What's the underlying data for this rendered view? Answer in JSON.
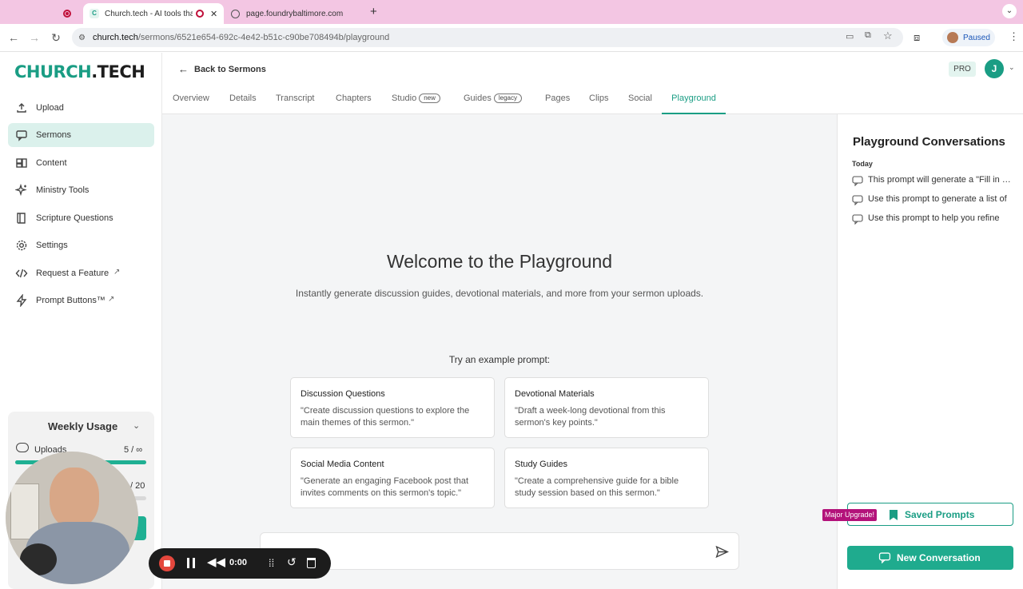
{
  "browser": {
    "tabs": [
      {
        "label": ""
      },
      {
        "label": "Church.tech - AI tools tha"
      },
      {
        "label": "page.foundrybaltimore.com"
      }
    ],
    "url_host": "church.tech",
    "url_path": "/sermons/6521e654-692c-4e42-b51c-c90be708494b/playground",
    "profile_status": "Paused"
  },
  "sidebar": {
    "logo_main": "CHURCH",
    "logo_dot": ".TECH",
    "items": [
      {
        "label": "Upload",
        "icon": "upload-icon"
      },
      {
        "label": "Sermons",
        "icon": "chat-icon"
      },
      {
        "label": "Content",
        "icon": "content-icon"
      },
      {
        "label": "Ministry Tools",
        "icon": "sparkle-icon"
      },
      {
        "label": "Scripture Questions",
        "icon": "book-icon"
      },
      {
        "label": "Settings",
        "icon": "gear-icon"
      },
      {
        "label": "Request a Feature",
        "icon": "code-icon"
      },
      {
        "label": "Prompt Buttons™",
        "icon": "bolt-icon"
      }
    ],
    "usage": {
      "title": "Weekly Usage",
      "uploads_label": "Uploads",
      "uploads_value": "5 / ∞",
      "uploads_fill": 1.0,
      "second_value": "/ 20",
      "second_fill": 0.4
    }
  },
  "header": {
    "back_label": "Back to Sermons",
    "plan_badge": "PRO",
    "avatar_initial": "J",
    "tabs": [
      {
        "label": "Overview"
      },
      {
        "label": "Details"
      },
      {
        "label": "Transcript"
      },
      {
        "label": "Chapters"
      },
      {
        "label": "Studio",
        "badge": "new"
      },
      {
        "label": "Guides",
        "badge": "legacy"
      },
      {
        "label": "Pages"
      },
      {
        "label": "Clips"
      },
      {
        "label": "Social"
      },
      {
        "label": "Playground"
      }
    ]
  },
  "main": {
    "title": "Welcome to the Playground",
    "subtitle": "Instantly generate discussion guides, devotional materials, and more from your sermon uploads.",
    "examples_heading": "Try an example prompt:",
    "examples": [
      {
        "title": "Discussion Questions",
        "desc": "\"Create discussion questions to explore the main themes of this sermon.\""
      },
      {
        "title": "Devotional Materials",
        "desc": "\"Draft a week-long devotional from this sermon's key points.\""
      },
      {
        "title": "Social Media Content",
        "desc": "\"Generate an engaging Facebook post that invites comments on this sermon's topic.\""
      },
      {
        "title": "Study Guides",
        "desc": "\"Create a comprehensive guide for a bible study session based on this sermon.\""
      }
    ]
  },
  "right_panel": {
    "title": "Playground Conversations",
    "group_label": "Today",
    "conversations": [
      {
        "label": "This prompt will generate a \"Fill in the blank\""
      },
      {
        "label": "Use this prompt to generate a list of"
      },
      {
        "label": "Use this prompt to help you refine"
      }
    ],
    "upgrade_badge": "Major Upgrade!",
    "saved_label": "Saved Prompts",
    "new_conv_label": "New Conversation"
  },
  "recorder": {
    "time": "0:00"
  },
  "colors": {
    "brand": "#1a9d84",
    "browser_frame": "#f3c6e3",
    "upgrade_badge": "#b3127a"
  }
}
